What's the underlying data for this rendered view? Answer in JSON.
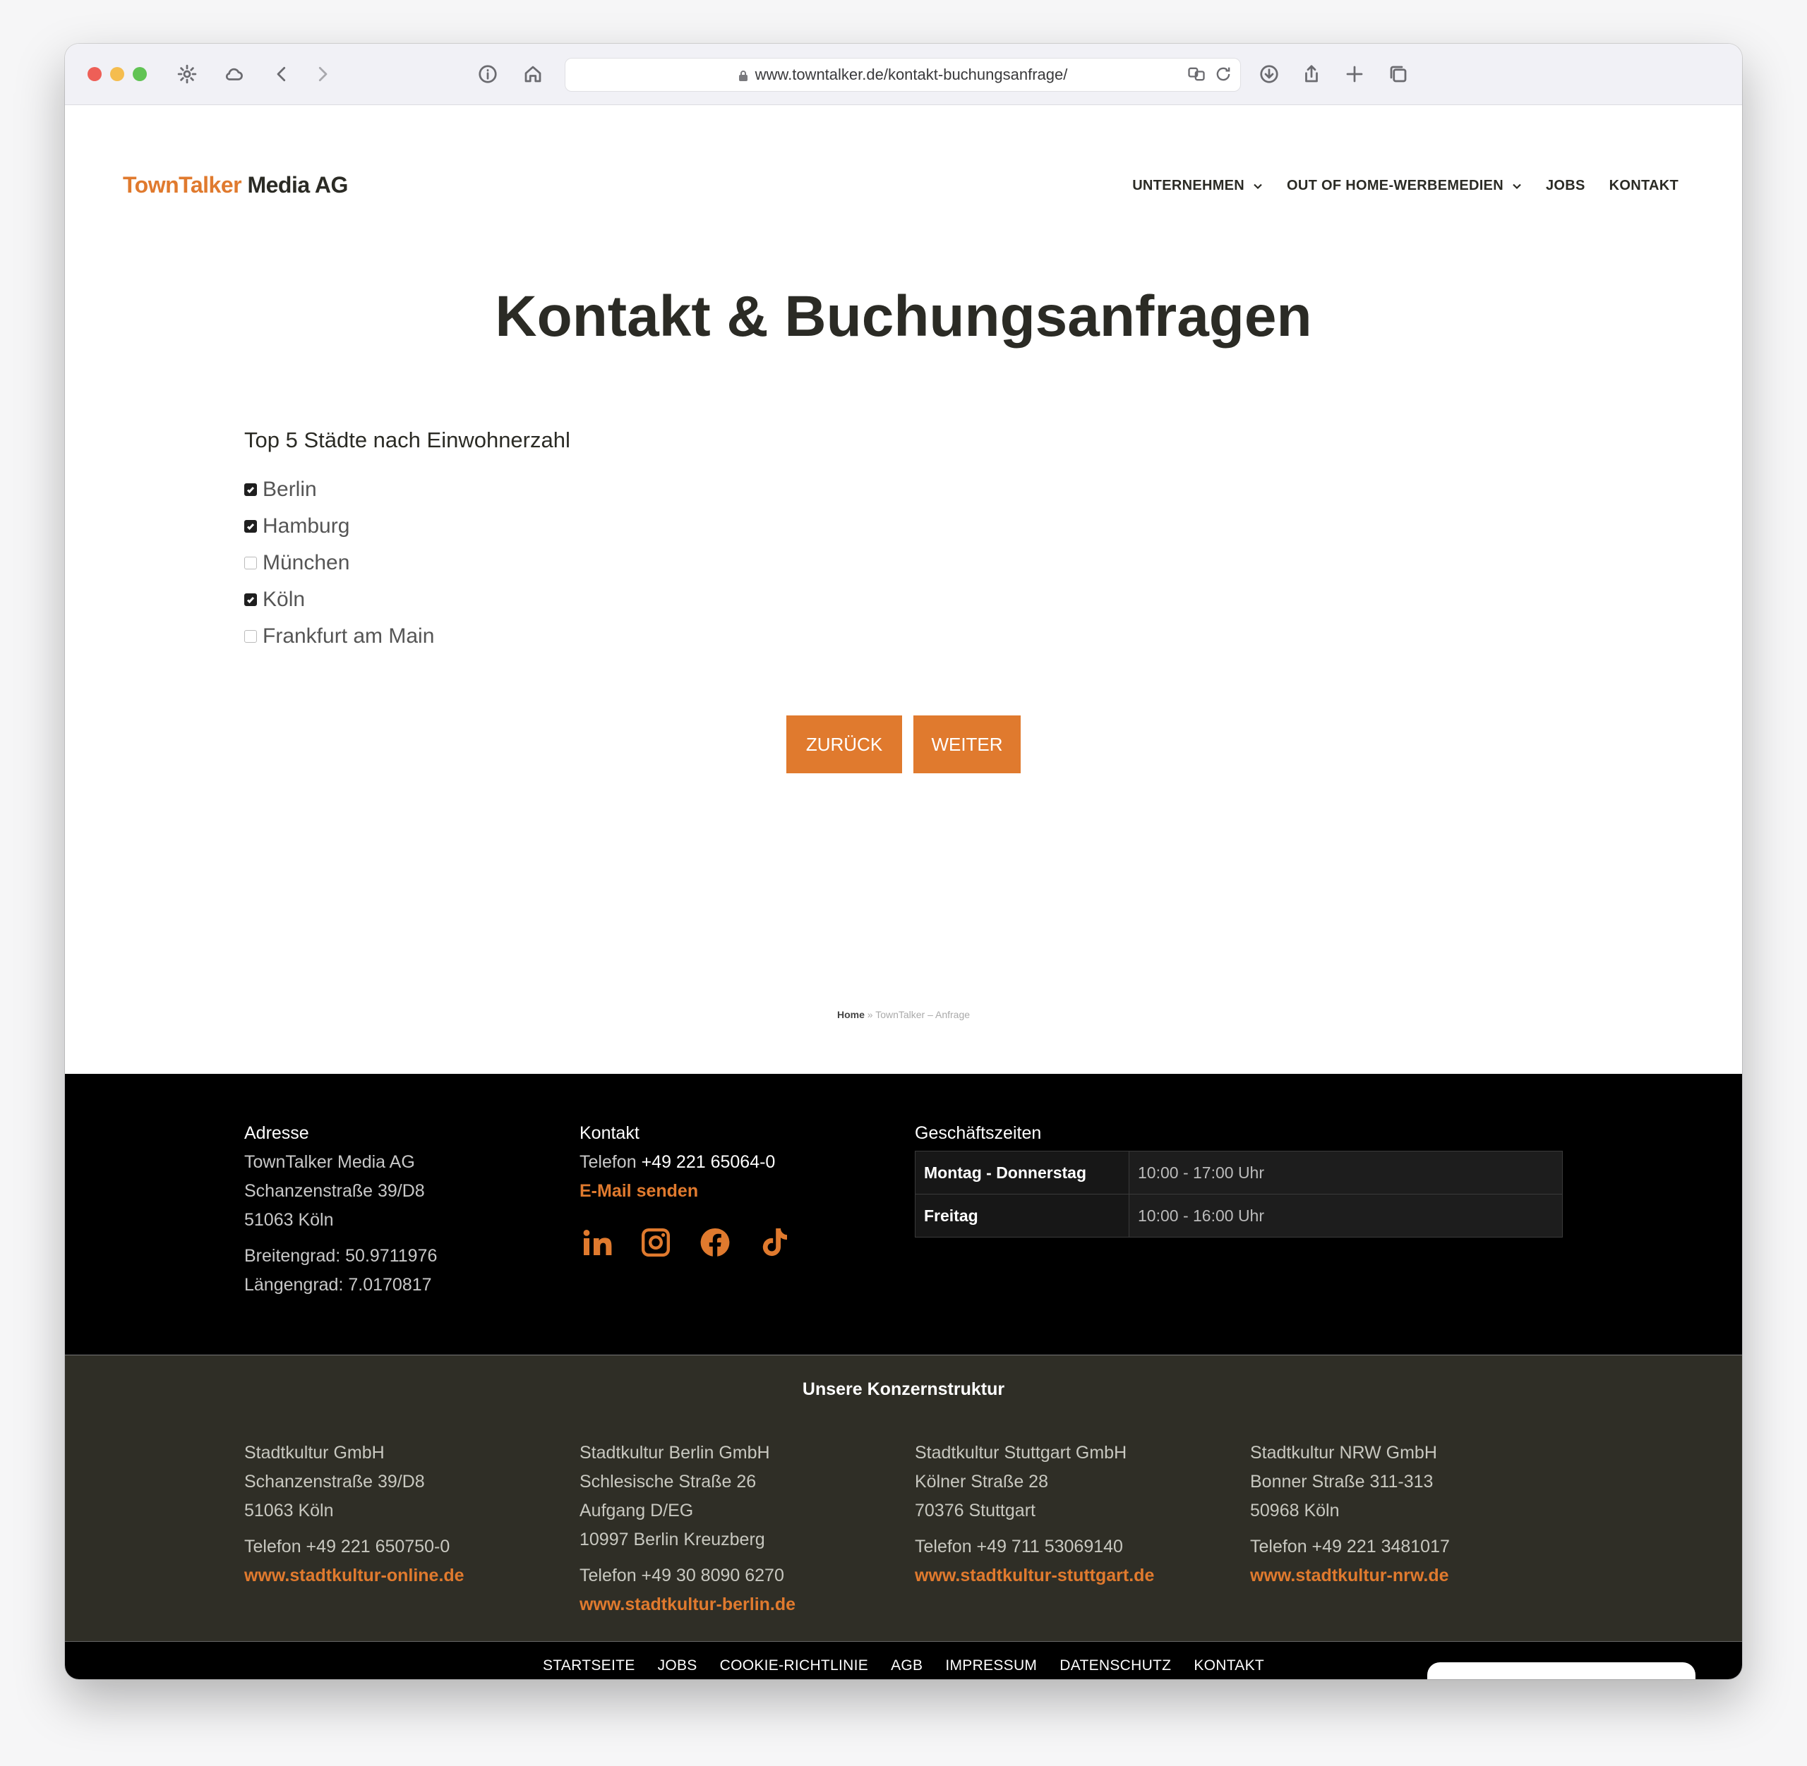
{
  "browser": {
    "url": "www.towntalker.de/kontakt-buchungsanfrage/"
  },
  "header": {
    "logo_part1": "TownTalker",
    "logo_part2": "Media AG",
    "nav": [
      "UNTERNEHMEN",
      "OUT OF HOME-WERBEMEDIEN",
      "JOBS",
      "KONTAKT"
    ]
  },
  "main": {
    "title": "Kontakt & Buchungsanfragen",
    "question": "Top 5 Städte nach Einwohnerzahl",
    "options": [
      {
        "label": "Berlin",
        "checked": true
      },
      {
        "label": "Hamburg",
        "checked": true
      },
      {
        "label": "München",
        "checked": false
      },
      {
        "label": "Köln",
        "checked": true
      },
      {
        "label": "Frankfurt am Main",
        "checked": false
      }
    ],
    "back_label": "ZURÜCK",
    "next_label": "WEITER"
  },
  "breadcrumb": {
    "home": "Home",
    "separator": "»",
    "current": "TownTalker – Anfrage"
  },
  "footer": {
    "address": {
      "title": "Adresse",
      "company": "TownTalker Media AG",
      "street": "Schanzenstraße 39/D8",
      "city": "51063 Köln",
      "lat": "Breitengrad: 50.9711976",
      "lng": "Längengrad: 7.0170817"
    },
    "contact": {
      "title": "Kontakt",
      "phone_label": "Telefon",
      "phone": "+49 221 65064-0",
      "email": "E-Mail senden",
      "social": [
        "linkedin-icon",
        "instagram-icon",
        "facebook-icon",
        "tiktok-icon"
      ]
    },
    "hours": {
      "title": "Geschäftszeiten",
      "rows": [
        {
          "day": "Montag - Donnerstag",
          "time": "10:00 - 17:00 Uhr"
        },
        {
          "day": "Freitag",
          "time": "10:00 - 16:00 Uhr"
        }
      ]
    },
    "group": {
      "title": "Unsere Konzernstruktur",
      "companies": [
        {
          "name": "Stadtkultur GmbH",
          "lines": [
            "Schanzenstraße 39/D8",
            "51063 Köln"
          ],
          "phone": "Telefon +49 221 650750-0",
          "web": "www.stadtkultur-online.de"
        },
        {
          "name": "Stadtkultur Berlin GmbH",
          "lines": [
            "Schlesische Straße 26",
            "Aufgang D/EG",
            "10997 Berlin Kreuzberg"
          ],
          "phone": "Telefon +49 30 8090 6270",
          "web": "www.stadtkultur-berlin.de"
        },
        {
          "name": "Stadtkultur Stuttgart GmbH",
          "lines": [
            "Kölner Straße 28",
            "70376 Stuttgart"
          ],
          "phone": "Telefon +49 711 53069140",
          "web": "www.stadtkultur-stuttgart.de"
        },
        {
          "name": "Stadtkultur NRW GmbH",
          "lines": [
            "Bonner Straße 311-313",
            "50968 Köln"
          ],
          "phone": "Telefon +49 221 3481017",
          "web": "www.stadtkultur-nrw.de"
        }
      ]
    },
    "links": [
      "STARTSEITE",
      "JOBS",
      "COOKIE-RICHTLINIE",
      "AGB",
      "IMPRESSUM",
      "DATENSCHUTZ",
      "KONTAKT"
    ]
  },
  "colors": {
    "accent": "#e07a2e",
    "dark": "#2b2b25",
    "footer_bg": "#000000",
    "group_bg": "#2f2e26"
  }
}
